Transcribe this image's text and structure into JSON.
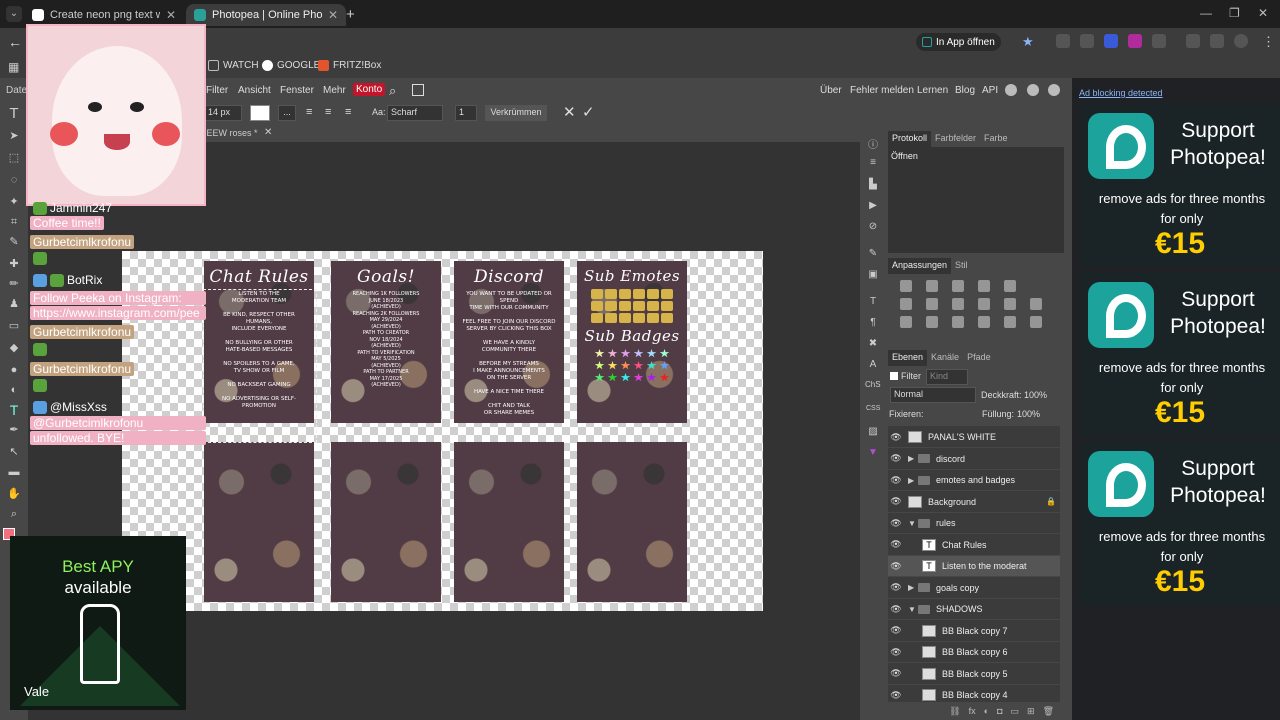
{
  "browser": {
    "tabs": [
      {
        "title": "Create neon png text with a tra",
        "active": false
      },
      {
        "title": "Photopea | Online Photo Editor",
        "active": true
      }
    ],
    "in_app_button": "In App öffnen",
    "bookmarks": [
      "WATCH",
      "GOOGLE",
      "FRITZ!Box"
    ],
    "left_label": "Date"
  },
  "photopea": {
    "menu": [
      "Filter",
      "Ansicht",
      "Fenster",
      "Mehr"
    ],
    "konto": "Konto",
    "right_menu": [
      "Über",
      "Fehler melden",
      "Lernen",
      "Blog",
      "API"
    ],
    "options": {
      "font_size": "14 px",
      "aa_label": "Aa:",
      "aa_value": "Scharf",
      "warp_button": "Verkrümmen",
      "ellipsis": "...",
      "line_value": "1"
    },
    "doc_tab": "IEEW roses *",
    "panels": {
      "history_tabs": [
        "Protokoll",
        "Farbfelder",
        "Farbe"
      ],
      "history_items": [
        "Öffnen"
      ],
      "adjust_tabs": [
        "Anpassungen",
        "Stil"
      ],
      "layers_tabs": [
        "Ebenen",
        "Kanäle",
        "Pfade"
      ],
      "filter_label": "Filter",
      "kind_label": "Kind",
      "blend_mode": "Normal",
      "opacity_label": "Deckkraft:",
      "opacity_value": "100%",
      "lock_label": "Fixieren:",
      "fill_label": "Füllung:",
      "fill_value": "100%",
      "side_label": "ChS",
      "layers": [
        {
          "name": "PANAL'S WHITE",
          "type": "image",
          "indent": 0
        },
        {
          "name": "discord",
          "type": "folder",
          "indent": 0,
          "open": false
        },
        {
          "name": "emotes and badges",
          "type": "folder",
          "indent": 0,
          "open": false
        },
        {
          "name": "Background",
          "type": "image",
          "indent": 0,
          "locked": true
        },
        {
          "name": "rules",
          "type": "folder",
          "indent": 0,
          "open": true
        },
        {
          "name": "Chat Rules",
          "type": "text",
          "indent": 1
        },
        {
          "name": "Listen to the moderat",
          "type": "text",
          "indent": 1,
          "selected": true
        },
        {
          "name": "goals copy",
          "type": "folder",
          "indent": 0,
          "open": false
        },
        {
          "name": "SHADOWS",
          "type": "folder",
          "indent": 0,
          "open": true
        },
        {
          "name": "BB Black copy 7",
          "type": "image",
          "indent": 1
        },
        {
          "name": "BB Black copy 6",
          "type": "image",
          "indent": 1
        },
        {
          "name": "BB Black copy 5",
          "type": "image",
          "indent": 1
        },
        {
          "name": "BB Black copy 4",
          "type": "image",
          "indent": 1
        }
      ]
    },
    "cards": [
      {
        "title": "Chat Rules",
        "body": "Listen to the\nmoderation team\n\nBe kind, respect other humans,\ninclude everyone\n\nNo bullying or other\nhate-based messages\n\nNo spoilers to a game,\ntv show or film\n\nNo backseat gaming\n\nNo advertising or self-promotion"
      },
      {
        "title": "Goals!",
        "body": "Reaching 1k followers\nJune 18/2023\n(Achieved)\nReaching 2k followers\nMay 29/2024\n(Achieved)\nPath to creator\nNov 18/2024\n(Achieved)\nPath to verification\nMay 5/2025\n(Achieved)\nPath to partner\nMay 17/2025\n(Achieved)"
      },
      {
        "title": "Discord",
        "body": "You want to be updated or spend\ntime with our community\n\nFeel free to join our discord\nserver by clicking this box\n\nWe have a kindly\ncommunity there\n\nBefore my streams\nI make announcements\non the server\n\nHave a nice time there\n\nChit and talk\nor share memes"
      },
      {
        "title": "Sub Emotes",
        "subtitle": "Sub Badges"
      }
    ]
  },
  "overlay": {
    "chat": [
      {
        "text": "Jammin247",
        "style": "user"
      },
      {
        "text": "Coffee time!!",
        "style": "pink"
      },
      {
        "text": "Gurbetcimlkrofonu",
        "style": "tan"
      },
      {
        "text": "BotRix",
        "style": "user"
      },
      {
        "text": "Follow Peeka on Instagram:",
        "style": "pink"
      },
      {
        "text": "https://www.instagram.com/pee",
        "style": "pink"
      },
      {
        "text": "Gurbetcimlkrofonu",
        "style": "tan"
      },
      {
        "text": "Gurbetcimlkrofonu",
        "style": "tan"
      },
      {
        "text": "@MissXss",
        "style": "user"
      },
      {
        "text": "@Gurbetcimlkrofonu",
        "style": "pink"
      },
      {
        "text": "unfollowed. BYE!",
        "style": "pink"
      }
    ],
    "promo": {
      "line1": "Best APY",
      "line2": "available",
      "brand": "Vale"
    }
  },
  "ads": {
    "notice": "Ad blocking detected",
    "items": [
      {
        "heading1": "Support",
        "heading2": "Photopea!",
        "sub1": "remove ads for three months",
        "sub2": "for only",
        "price": "€15"
      },
      {
        "heading1": "Support",
        "heading2": "Photopea!",
        "sub1": "remove ads for three months",
        "sub2": "for only",
        "price": "€15"
      },
      {
        "heading1": "Support",
        "heading2": "Photopea!",
        "sub1": "remove ads for three months",
        "sub2": "for only",
        "price": "€15"
      }
    ]
  },
  "colors": {
    "accent": "#1ba39c",
    "konto": "#c0152a",
    "price": "#ffcd00",
    "card_bg": "#513b45"
  }
}
